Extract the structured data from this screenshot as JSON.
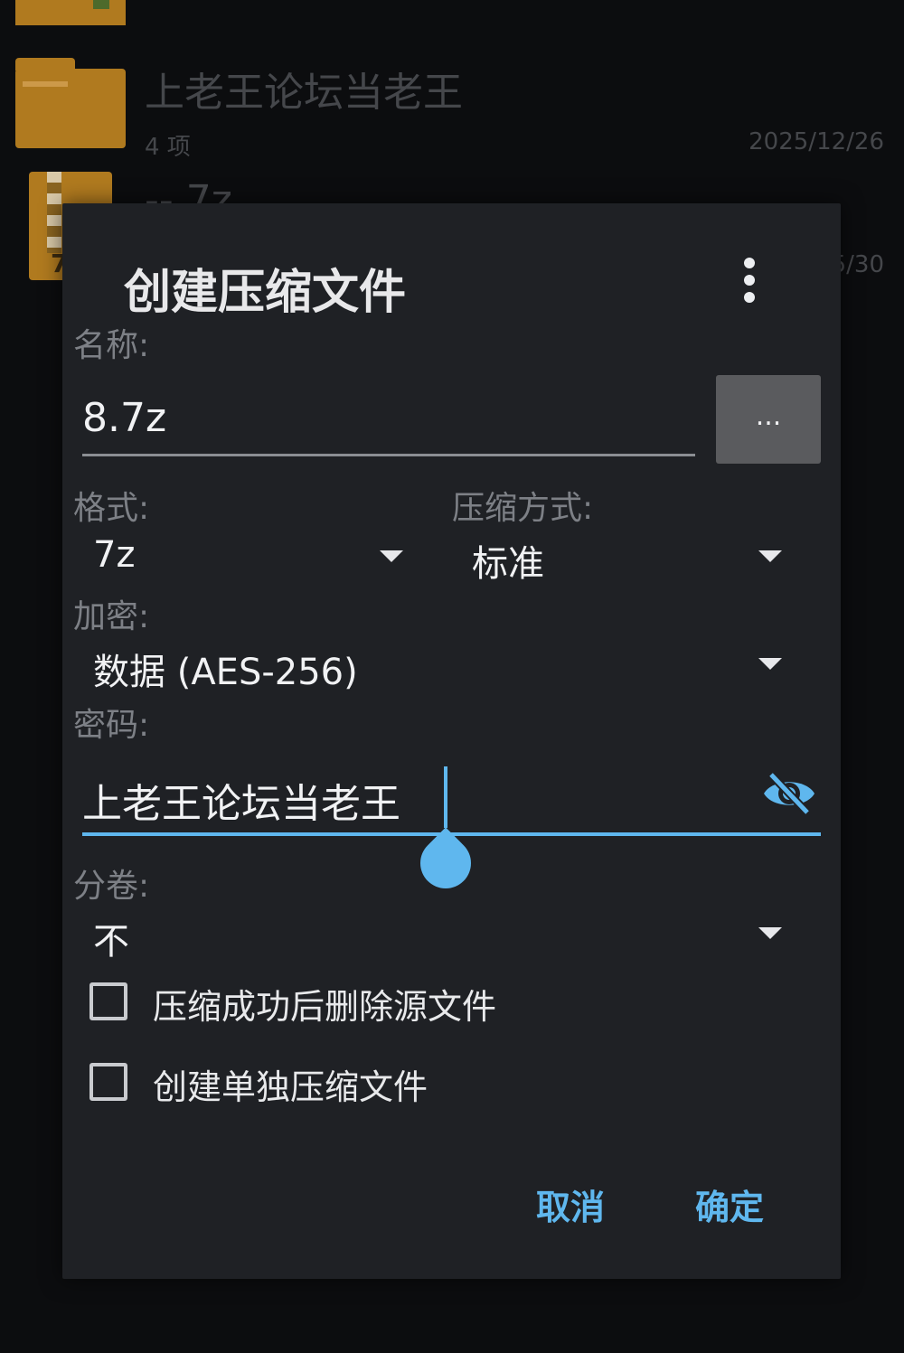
{
  "background": {
    "folder_name": "上老王论坛当老王",
    "folder_count": "4 项",
    "folder_date": "2025/12/26",
    "second_item_name": "-- 7z",
    "second_item_date": "5/30",
    "archive_badge": "7"
  },
  "dialog": {
    "title": "创建压缩文件",
    "name_label": "名称:",
    "name_value": "8.7z",
    "browse_label": "...",
    "format_label": "格式:",
    "format_value": "7z",
    "method_label": "压缩方式:",
    "method_value": "标准",
    "encryption_label": "加密:",
    "encryption_value": "数据 (AES-256)",
    "password_label": "密码:",
    "password_value": "上老王论坛当老王",
    "split_label": "分卷:",
    "split_value": "不",
    "delete_source_label": "压缩成功后删除源文件",
    "delete_source_checked": false,
    "separate_archives_label": "创建单独压缩文件",
    "separate_archives_checked": false,
    "cancel_label": "取消",
    "ok_label": "确定"
  },
  "colors": {
    "accent": "#5fb7ee",
    "dialog_bg": "#1f2125",
    "folder": "#b07a1f"
  },
  "icons": {
    "more": "more-vert-icon",
    "visibility": "eye-off-icon",
    "dropdown": "arrow-drop-down-icon"
  }
}
